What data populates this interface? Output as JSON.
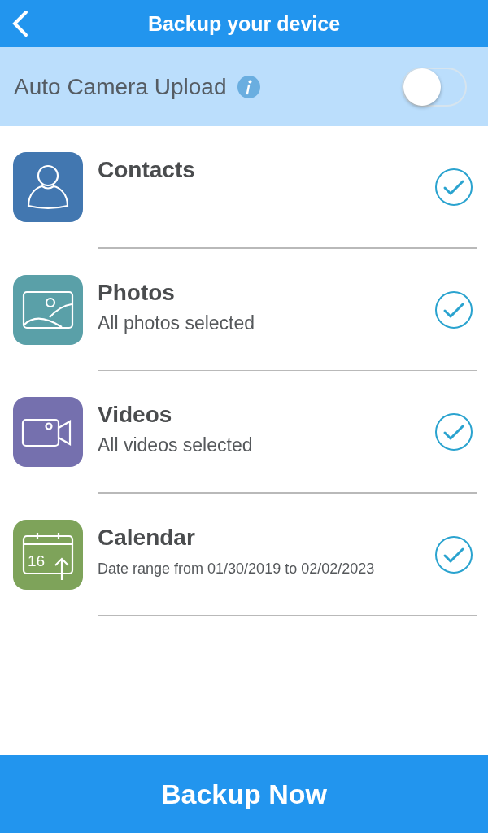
{
  "header": {
    "title": "Backup your device"
  },
  "auto_upload": {
    "label": "Auto Camera Upload",
    "on": false
  },
  "items": [
    {
      "kind": "contacts",
      "title": "Contacts",
      "color": "#4277b0",
      "checked": true
    },
    {
      "kind": "photos",
      "title": "Photos",
      "subtitle": "All photos selected",
      "color": "#5aa0a8",
      "checked": true
    },
    {
      "kind": "videos",
      "title": "Videos",
      "subtitle": "All videos selected",
      "color": "#7570ae",
      "checked": true
    },
    {
      "kind": "calendar",
      "title": "Calendar",
      "subtitle": "Date range from 01/30/2019 to 02/02/2023",
      "small_subtitle": true,
      "icon_label": "16",
      "color": "#7ea35a",
      "checked": true
    }
  ],
  "action": {
    "label": "Backup Now"
  }
}
